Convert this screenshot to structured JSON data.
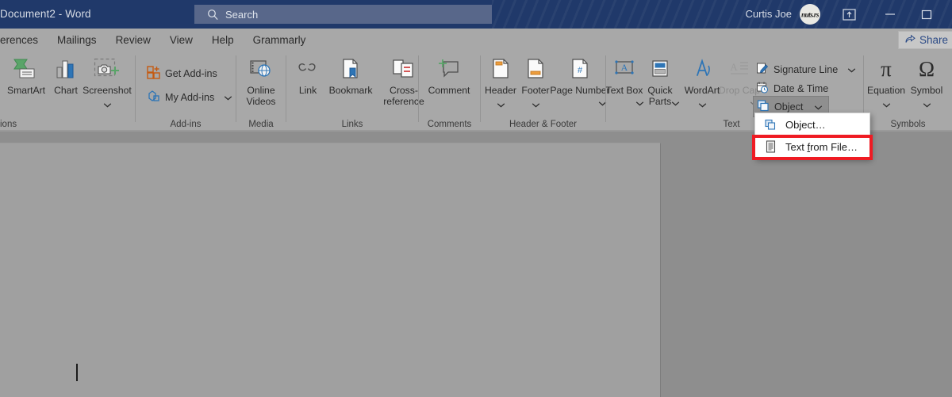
{
  "titlebar": {
    "document_title": "Document2  -  Word",
    "search_placeholder": "Search",
    "user_name": "Curtis Joe",
    "avatar_mark": "nuts.rs",
    "icons": {
      "search": "search-icon",
      "ribbon_display_options": "ribbon-display-options-icon",
      "minimize": "minimize-icon",
      "maximize": "maximize-icon"
    },
    "colors": {
      "background": "#20396a",
      "search_field": "#58678a"
    }
  },
  "tabs": [
    {
      "label": "erences"
    },
    {
      "label": "Mailings"
    },
    {
      "label": "Review"
    },
    {
      "label": "View"
    },
    {
      "label": "Help"
    },
    {
      "label": "Grammarly"
    }
  ],
  "share": {
    "label": "Share",
    "icon": "share-icon"
  },
  "ribbon": {
    "groups": [
      {
        "name": "illustrations",
        "label": "ions",
        "buttons": [
          {
            "label": "SmartArt",
            "icon": "smartart-icon"
          },
          {
            "label": "Chart",
            "icon": "chart-icon"
          },
          {
            "label": "Screenshot",
            "icon": "screenshot-icon",
            "has_chevron": true
          }
        ]
      },
      {
        "name": "add-ins",
        "label": "Add-ins",
        "buttons": [
          {
            "label": "Get Add-ins",
            "icon": "get-addins-icon"
          },
          {
            "label": "My Add-ins",
            "icon": "my-addins-icon",
            "has_chevron": true
          }
        ]
      },
      {
        "name": "media",
        "label": "Media",
        "buttons": [
          {
            "label": "Online Videos",
            "icon": "online-videos-icon"
          }
        ]
      },
      {
        "name": "links",
        "label": "Links",
        "buttons": [
          {
            "label": "Link",
            "icon": "link-icon"
          },
          {
            "label": "Bookmark",
            "icon": "bookmark-icon"
          },
          {
            "label": "Cross-reference",
            "icon": "cross-reference-icon"
          }
        ]
      },
      {
        "name": "comments",
        "label": "Comments",
        "buttons": [
          {
            "label": "Comment",
            "icon": "comment-icon"
          }
        ]
      },
      {
        "name": "header-footer",
        "label": "Header & Footer",
        "buttons": [
          {
            "label": "Header",
            "icon": "header-icon",
            "has_chevron": true
          },
          {
            "label": "Footer",
            "icon": "footer-icon",
            "has_chevron": true
          },
          {
            "label": "Page Number",
            "icon": "page-number-icon",
            "has_chevron": true
          }
        ]
      },
      {
        "name": "text",
        "label": "Text",
        "buttons": [
          {
            "label": "Text Box",
            "icon": "text-box-icon",
            "has_chevron": true
          },
          {
            "label": "Quick Parts",
            "icon": "quick-parts-icon",
            "has_chevron": true
          },
          {
            "label": "WordArt",
            "icon": "wordart-icon",
            "has_chevron": true
          },
          {
            "label": "Drop Cap",
            "icon": "drop-cap-icon",
            "has_chevron": true,
            "disabled": true
          }
        ],
        "small_buttons": [
          {
            "label": "Signature Line",
            "icon": "signature-line-icon",
            "has_chevron": true
          },
          {
            "label": "Date & Time",
            "icon": "date-time-icon"
          },
          {
            "label": "Object",
            "icon": "object-icon",
            "has_chevron": true,
            "pressed": true
          }
        ]
      },
      {
        "name": "symbols",
        "label": "Symbols",
        "buttons": [
          {
            "label": "Equation",
            "icon": "equation-icon",
            "glyph": "π",
            "has_chevron": true
          },
          {
            "label": "Symbol",
            "icon": "symbol-icon",
            "glyph": "Ω",
            "has_chevron": true
          }
        ]
      }
    ]
  },
  "object_menu": {
    "items": [
      {
        "label_pre": "Ob",
        "label_key": "j",
        "label_post": "ect…",
        "icon": "object-icon",
        "highlighted": false
      },
      {
        "label_pre": "Text ",
        "label_key": "f",
        "label_post": "rom File…",
        "icon": "text-from-file-icon",
        "highlighted": true
      }
    ],
    "annotation_color": "#ef1b23"
  },
  "document": {
    "caret_visible": true,
    "page_color": "#a0a0a0",
    "canvas_color": "#8e8e8e"
  }
}
